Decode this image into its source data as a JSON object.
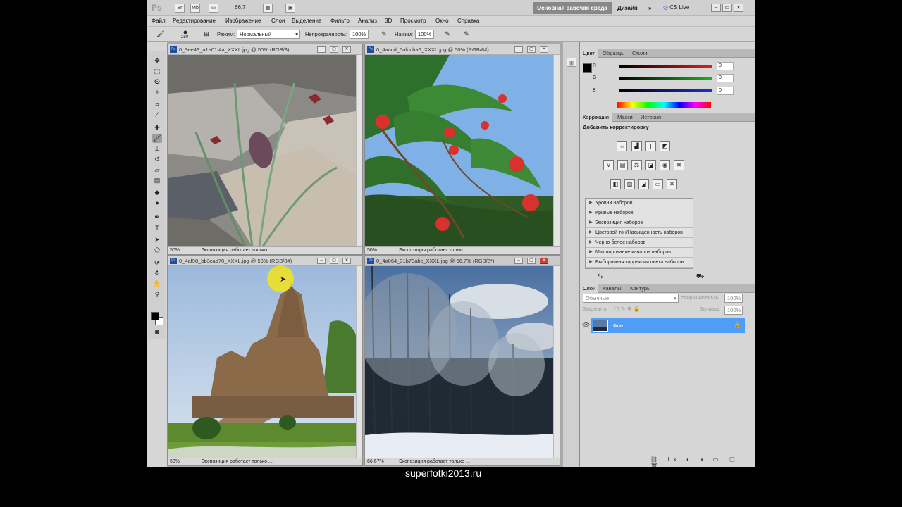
{
  "appbar": {
    "logo": "Ps",
    "zoom": "66,7",
    "workspace_main": "Основная рабочая среда",
    "workspace_design": "Дизайн",
    "more": "»",
    "cslive": "CS Live"
  },
  "menu": [
    "Файл",
    "Редактирование",
    "Изображение",
    "Слои",
    "Выделение",
    "Фильтр",
    "Анализ",
    "3D",
    "Просмотр",
    "Окно",
    "Справка"
  ],
  "options": {
    "brush_size": "250",
    "mode_label": "Режим:",
    "mode_value": "Нормальный",
    "opacity_label": "Непрозрачность:",
    "opacity_value": "100%",
    "pressure_label": "Нажим:",
    "pressure_value": "100%"
  },
  "documents": [
    {
      "title": "0_3ee43_a1a01f4a_XXXL.jpg @ 50% (RGB/8)",
      "zoom": "50%",
      "status": "Экспозиция работает только ..."
    },
    {
      "title": "0_4aacd_5afdcba6_XXXL.jpg @ 50% (RGB/8#)",
      "zoom": "50%",
      "status": "Экспозиция работает только ..."
    },
    {
      "title": "0_4af98_bb3cad70_XXXL.jpg @ 50% (RGB/8#)",
      "zoom": "50%",
      "status": "Экспозиция работает только ..."
    },
    {
      "title": "0_4a064_31b73abc_XXXL.jpg @ 66,7% (RGB/8*)",
      "zoom": "66,67%",
      "status": "Экспозиция работает только ..."
    }
  ],
  "color_panel": {
    "tabs": [
      "Цвет",
      "Образцы",
      "Стили"
    ],
    "channels": [
      {
        "label": "R",
        "value": "0",
        "color": "#e02020"
      },
      {
        "label": "G",
        "value": "0",
        "color": "#20b020"
      },
      {
        "label": "B",
        "value": "0",
        "color": "#2030d0"
      }
    ]
  },
  "adjustments_panel": {
    "tabs": [
      "Коррекция",
      "Маски",
      "История"
    ],
    "heading": "Добавить корректировку",
    "presets": [
      "Уровни наборов",
      "Кривые наборов",
      "Экспозиция наборов",
      "Цветовой тон/Насыщенность наборов",
      "Черно-белое наборов",
      "Микширование каналов наборов",
      "Выборочная коррекция цвета наборов"
    ]
  },
  "layers_panel": {
    "tabs": [
      "Слои",
      "Каналы",
      "Контуры"
    ],
    "blend_mode": "Обычные",
    "opacity_label": "Непрозрачность:",
    "opacity_value": "100%",
    "lock_label": "Закрепить:",
    "fill_label": "Заливка:",
    "fill_value": "100%",
    "layer_name": "Фон"
  },
  "footer": "superfotki2013.ru",
  "colors": {
    "layer_selected": "#4f9df6",
    "workspace_active": "#888888",
    "close_button": "#c8433a"
  }
}
